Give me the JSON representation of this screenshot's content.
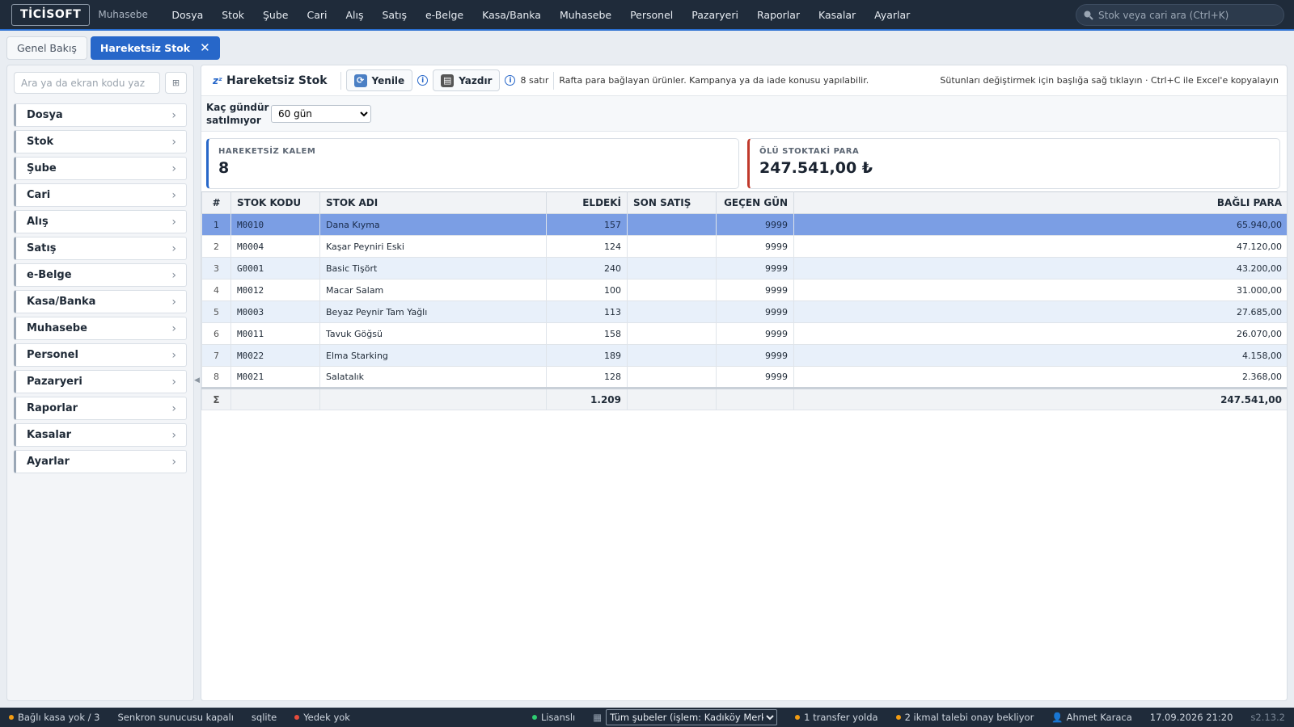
{
  "app": {
    "logo": "TİCİSOFT",
    "subtitle": "Muhasebe"
  },
  "top_menu": [
    "Dosya",
    "Stok",
    "Şube",
    "Cari",
    "Alış",
    "Satış",
    "e-Belge",
    "Kasa/Banka",
    "Muhasebe",
    "Personel",
    "Pazaryeri",
    "Raporlar",
    "Kasalar",
    "Ayarlar"
  ],
  "global_search": {
    "placeholder": "Stok veya cari ara (Ctrl+K)"
  },
  "tabs": [
    {
      "label": "Genel Bakış",
      "active": false
    },
    {
      "label": "Hareketsiz Stok",
      "active": true,
      "close": "✕"
    }
  ],
  "sidebar": {
    "search_placeholder": "Ara ya da ekran kodu yaz",
    "grid_button": "⊞",
    "items": [
      "Dosya",
      "Stok",
      "Şube",
      "Cari",
      "Alış",
      "Satış",
      "e-Belge",
      "Kasa/Banka",
      "Muhasebe",
      "Personel",
      "Pazaryeri",
      "Raporlar",
      "Kasalar",
      "Ayarlar"
    ]
  },
  "toolbar": {
    "title_icon": "zᶻ",
    "title": "Hareketsiz Stok",
    "refresh_label": "Yenile",
    "print_label": "Yazdır",
    "info": "i",
    "row_count": "8 satır",
    "description": "Rafta para bağlayan ürünler. Kampanya ya da iade konusu yapılabilir.",
    "hint": "Sütunları değiştirmek için başlığa sağ tıklayın · Ctrl+C ile Excel'e kopyalayın"
  },
  "filter": {
    "label_line1": "Kaç gündür",
    "label_line2": "satılmıyor",
    "selected": "60 gün"
  },
  "cards": [
    {
      "label": "HAREKETSİZ KALEM",
      "value": "8",
      "accent": "#2767c9"
    },
    {
      "label": "ÖLÜ STOKTAKİ PARA",
      "value": "247.541,00 ₺",
      "accent": "#c0392b"
    }
  ],
  "table": {
    "headers": [
      "#",
      "STOK KODU",
      "STOK ADI",
      "ELDEKİ",
      "SON SATIŞ",
      "GEÇEN GÜN",
      "BAĞLI PARA"
    ],
    "rows": [
      {
        "n": "1",
        "code": "M0010",
        "name": "Dana Kıyma",
        "qty": "157",
        "last": "",
        "days": "9999",
        "money": "65.940,00"
      },
      {
        "n": "2",
        "code": "M0004",
        "name": "Kaşar Peyniri Eski",
        "qty": "124",
        "last": "",
        "days": "9999",
        "money": "47.120,00"
      },
      {
        "n": "3",
        "code": "G0001",
        "name": "Basic Tişört",
        "qty": "240",
        "last": "",
        "days": "9999",
        "money": "43.200,00"
      },
      {
        "n": "4",
        "code": "M0012",
        "name": "Macar Salam",
        "qty": "100",
        "last": "",
        "days": "9999",
        "money": "31.000,00"
      },
      {
        "n": "5",
        "code": "M0003",
        "name": "Beyaz Peynir Tam Yağlı",
        "qty": "113",
        "last": "",
        "days": "9999",
        "money": "27.685,00"
      },
      {
        "n": "6",
        "code": "M0011",
        "name": "Tavuk Göğsü",
        "qty": "158",
        "last": "",
        "days": "9999",
        "money": "26.070,00"
      },
      {
        "n": "7",
        "code": "M0022",
        "name": "Elma Starking",
        "qty": "189",
        "last": "",
        "days": "9999",
        "money": "4.158,00"
      },
      {
        "n": "8",
        "code": "M0021",
        "name": "Salatalık",
        "qty": "128",
        "last": "",
        "days": "9999",
        "money": "2.368,00"
      }
    ],
    "selected_row": 0,
    "total": {
      "symbol": "Σ",
      "qty": "1.209",
      "money": "247.541,00"
    }
  },
  "statusbar": {
    "cash": "Bağlı kasa yok / 3",
    "sync": "Senkron sunucusu kapalı",
    "db": "sqlite",
    "backup": "Yedek yok",
    "license": "Lisanslı",
    "branch": "Tüm şubeler (işlem: Kadıköy Merkez)",
    "transfer": "1 transfer yolda",
    "requests": "2 ikmal talebi onay bekliyor",
    "user": "Ahmet Karaca",
    "datetime": "17.09.2026 21:20",
    "version": "s2.13.2"
  },
  "colors": {
    "accent": "#2767c9",
    "topbar": "#1f2b3a",
    "selected_row": "#7b9ee4",
    "alt_row": "#e8f0fa",
    "danger": "#c0392b",
    "ok": "#2ecc71",
    "warn": "#f39c12"
  }
}
